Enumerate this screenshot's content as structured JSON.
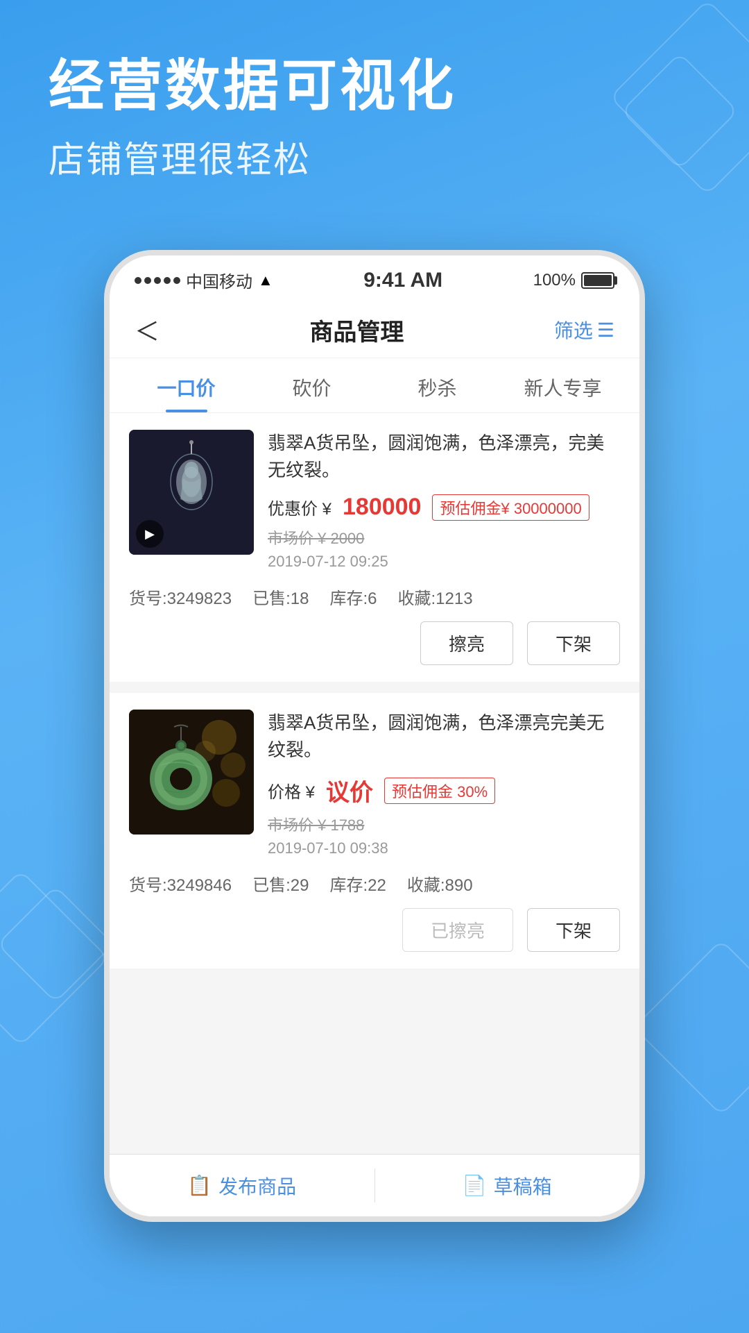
{
  "background": {
    "gradient_start": "#3a9eee",
    "gradient_end": "#4da6f0"
  },
  "header": {
    "title": "经营数据可视化",
    "subtitle": "店铺管理很轻松"
  },
  "status_bar": {
    "carrier": "中国移动",
    "time": "9:41 AM",
    "battery": "100%",
    "signal_dots": 5
  },
  "app_header": {
    "back_label": "‹",
    "title": "商品管理",
    "filter_label": "筛选"
  },
  "tabs": [
    {
      "label": "一口价",
      "active": true
    },
    {
      "label": "砍价",
      "active": false
    },
    {
      "label": "秒杀",
      "active": false
    },
    {
      "label": "新人专享",
      "active": false
    }
  ],
  "products": [
    {
      "title": "翡翠A货吊坠，圆润饱满，色泽漂亮，完美无纹裂。",
      "price_label": "优惠价 ¥",
      "price": "180000",
      "badge": "预估佣金¥ 30000000",
      "market_price": "市场价 ¥ 2000",
      "date": "2019-07-12 09:25",
      "sku": "货号:3249823",
      "sold": "已售:18",
      "stock": "库存:6",
      "favorites": "收藏:1213",
      "btn1": "擦亮",
      "btn2": "下架",
      "btn1_disabled": false
    },
    {
      "title": "翡翠A货吊坠，圆润饱满，色泽漂亮完美无纹裂。",
      "price_label": "价格 ¥",
      "price": "议价",
      "badge": "预估佣金 30%",
      "market_price": "市场价 ¥ 1788",
      "date": "2019-07-10 09:38",
      "sku": "货号:3249846",
      "sold": "已售:29",
      "stock": "库存:22",
      "favorites": "收藏:890",
      "btn1": "已擦亮",
      "btn2": "下架",
      "btn1_disabled": true
    }
  ],
  "footer": {
    "publish_label": "发布商品",
    "draft_label": "草稿箱"
  }
}
